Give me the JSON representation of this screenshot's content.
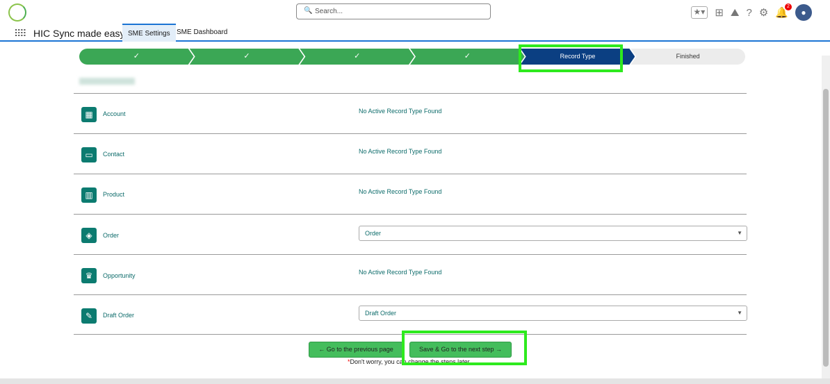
{
  "header": {
    "search_placeholder": "Search...",
    "notification_count": "2",
    "app_name": "HIC Sync made easy"
  },
  "tabs": [
    {
      "label": "SME Settings",
      "active": true
    },
    {
      "label": "SME Dashboard",
      "active": false
    }
  ],
  "path": {
    "steps": [
      "✓",
      "✓",
      "✓",
      "✓",
      "Record Type",
      "Finished"
    ],
    "current": "Record Type"
  },
  "rows": [
    {
      "label": "Account",
      "icon": "building-icon",
      "value": "No Active Record Type Found"
    },
    {
      "label": "Contact",
      "icon": "contact-card-icon",
      "value": "No Active Record Type Found"
    },
    {
      "label": "Product",
      "icon": "barcode-icon",
      "value": "No Active Record Type Found"
    },
    {
      "label": "Order",
      "icon": "layers-icon",
      "select": "Order"
    },
    {
      "label": "Opportunity",
      "icon": "crown-icon",
      "value": "No Active Record Type Found"
    },
    {
      "label": "Draft Order",
      "icon": "draft-icon",
      "select": "Draft Order"
    }
  ],
  "buttons": {
    "previous": "Go to the previous page",
    "next": "Save & Go to the next step"
  },
  "note": {
    "asterisk": "*",
    "text": "Don't worry, you can change the steps later"
  },
  "colors": {
    "primary_green": "#3ba755",
    "current_step": "#0b3f82",
    "icon_teal": "#0c7b70",
    "highlight": "#2eea1e"
  }
}
